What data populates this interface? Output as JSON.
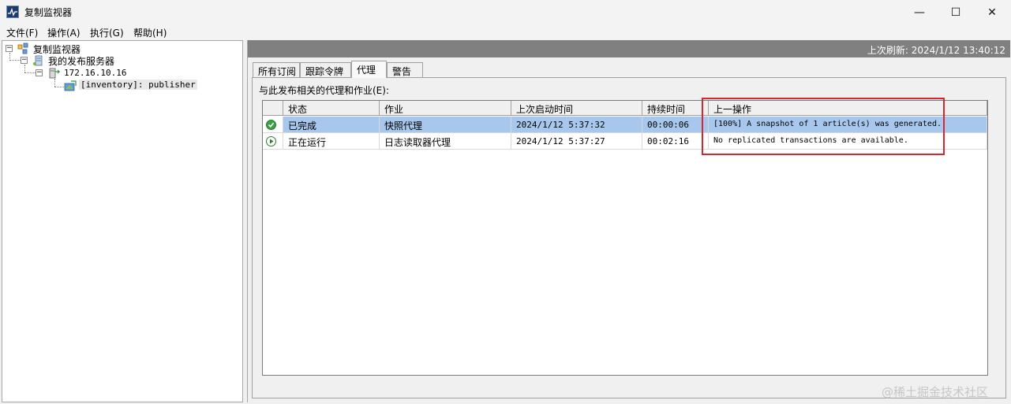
{
  "window": {
    "title": "复制监视器",
    "controls": {
      "minimize": "—",
      "maximize": "☐",
      "close": "✕"
    }
  },
  "menu": [
    "文件(F)",
    "操作(A)",
    "执行(G)",
    "帮助(H)"
  ],
  "tree": {
    "root": "复制监视器",
    "group": "我的发布服务器",
    "server": "172.16.10.16",
    "publication": "[inventory]: publisher"
  },
  "header": {
    "last_refresh": "上次刷新: 2024/1/12 13:40:12"
  },
  "tabs": [
    "所有订阅",
    "跟踪令牌",
    "代理",
    "警告"
  ],
  "active_tab": "代理",
  "section_label": "与此发布相关的代理和作业(E):",
  "grid": {
    "columns": [
      "状态",
      "作业",
      "上次启动时间",
      "持续时间",
      "上一操作"
    ],
    "rows": [
      {
        "status_icon": "check-circle-icon",
        "status": "已完成",
        "job": "快照代理",
        "start_time": "2024/1/12 5:37:32",
        "duration": "00:00:06",
        "last_action": "[100%] A snapshot of 1 article(s) was generated.",
        "selected": true
      },
      {
        "status_icon": "play-circle-icon",
        "status": "正在运行",
        "job": "日志读取器代理",
        "start_time": "2024/1/12 5:37:27",
        "duration": "00:02:16",
        "last_action": "No replicated transactions are available.",
        "selected": false
      }
    ]
  },
  "colors": {
    "selection": "#a7c8ec",
    "header_band": "#808080",
    "highlight_box": "#d9252f",
    "status_ok": "#3aa142"
  },
  "watermark": "@稀土掘金技术社区"
}
